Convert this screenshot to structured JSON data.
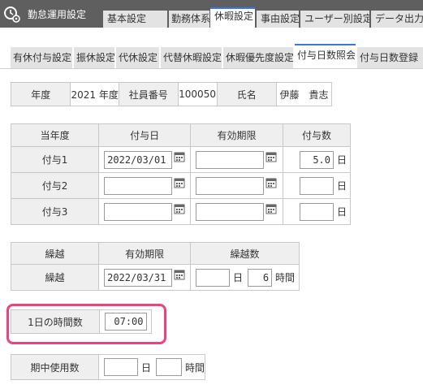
{
  "header": {
    "app_title": "勤怠運用設定",
    "tabs": [
      {
        "label": "基本設定"
      },
      {
        "label": "勤務体系設定"
      },
      {
        "label": "休暇設定"
      },
      {
        "label": "事由設定"
      },
      {
        "label": "ユーザー別設定"
      },
      {
        "label": "データ出力設定"
      }
    ]
  },
  "subtabs": [
    {
      "label": "有休付与設定"
    },
    {
      "label": "振休設定"
    },
    {
      "label": "代休設定"
    },
    {
      "label": "代替休暇設定"
    },
    {
      "label": "休暇優先度設定"
    },
    {
      "label": "付与日数照会"
    },
    {
      "label": "付与日数登録"
    }
  ],
  "info": {
    "year_label": "年度",
    "year_value": "2021 年度",
    "employee_no_label": "社員番号",
    "employee_no_value": "100050",
    "name_label": "氏名",
    "name_value": "伊藤　貴志"
  },
  "grant_table": {
    "headers": [
      "当年度",
      "付与日",
      "有効期限",
      "付与数"
    ],
    "day_unit": "日",
    "rows": [
      {
        "label": "付与1",
        "grant_date": "2022/03/01",
        "expiry": "",
        "count": "5.0"
      },
      {
        "label": "付与2",
        "grant_date": "",
        "expiry": "",
        "count": ""
      },
      {
        "label": "付与3",
        "grant_date": "",
        "expiry": "",
        "count": ""
      }
    ]
  },
  "carryover_table": {
    "headers": [
      "繰越",
      "有効期限",
      "繰越数"
    ],
    "row_label": "繰越",
    "expiry": "2022/03/31",
    "days": "",
    "day_unit": "日",
    "hours": "6",
    "hour_unit": "時間"
  },
  "hours_per_day": {
    "label": "1日の時間数",
    "value": "07:00"
  },
  "midterm_usage": {
    "label": "期中使用数",
    "days": "",
    "day_unit": "日",
    "hours": "",
    "hour_unit": "時間"
  },
  "colors": {
    "active_tab_accent": "#3b78d8",
    "highlight": "#e8457a",
    "header_bg": "#5f5f5f"
  }
}
